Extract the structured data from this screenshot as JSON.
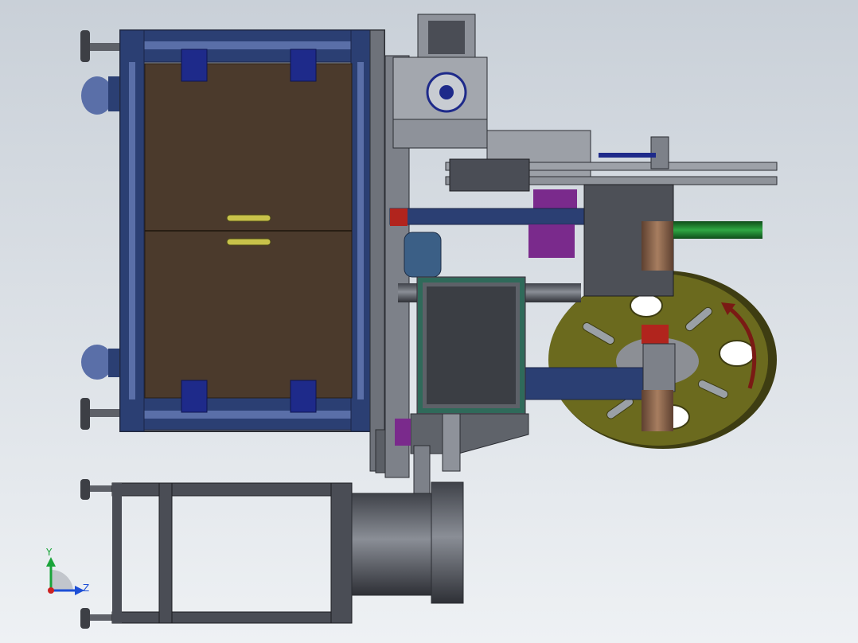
{
  "viewport": {
    "background_top": "#c9d0d8",
    "background_bottom": "#eef1f4"
  },
  "colors": {
    "frame_blue": "#2b3f73",
    "frame_blue_light": "#5a6fa8",
    "panel_brown": "#4b3a2c",
    "steel_dark": "#4a4d55",
    "steel_mid": "#7b7f87",
    "steel_light": "#a7abb2",
    "purple": "#7a2a8c",
    "green_rod": "#1f7a2e",
    "olive_disc": "#6b6a1e",
    "olive_dark": "#3e3d12",
    "red_block": "#b1241d",
    "bronze": "#8a6549",
    "teal_panel": "#2f6a5a",
    "arrow_red": "#7a1a14",
    "handle_yellow": "#c8c24a"
  },
  "triad": {
    "y_label": "Y",
    "z_label": "Z",
    "y_color": "#1aa43a",
    "z_color": "#1d4fd6",
    "x_color": "#cc2222"
  }
}
